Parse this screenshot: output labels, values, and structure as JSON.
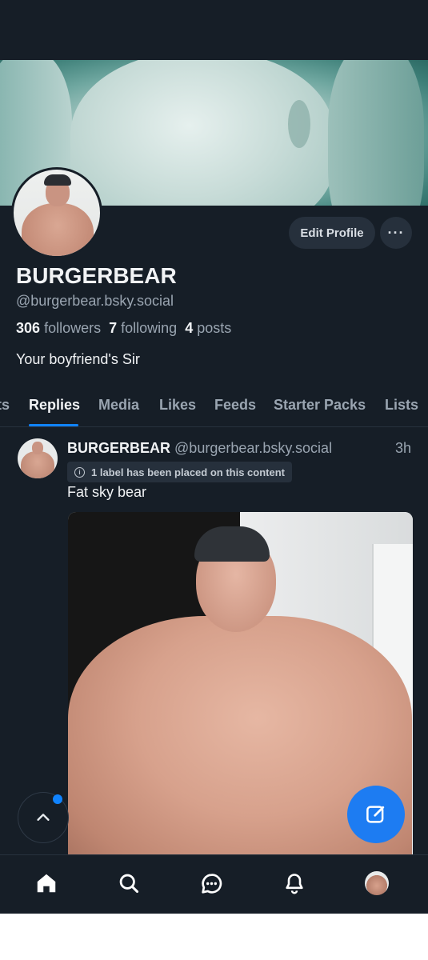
{
  "profile": {
    "display_name": "BURGERBEAR",
    "handle": "@burgerbear.bsky.social",
    "followers_count": "306",
    "followers_label": "followers",
    "following_count": "7",
    "following_label": "following",
    "posts_count": "4",
    "posts_label": "posts",
    "bio": "Your boyfriend's Sir",
    "edit_button": "Edit Profile",
    "more_button": "···"
  },
  "tabs": [
    "ts",
    "Replies",
    "Media",
    "Likes",
    "Feeds",
    "Starter Packs",
    "Lists"
  ],
  "active_tab": "Replies",
  "post": {
    "author": "BURGERBEAR",
    "handle": "@burgerbear.bsky.social",
    "time": "3h",
    "label_notice": "1 label has been placed on this content",
    "text": "Fat sky bear"
  },
  "nav": {
    "icons": [
      "home-icon",
      "search-icon",
      "chat-icon",
      "bell-icon",
      "profile-avatar"
    ]
  },
  "colors": {
    "background": "#161e27",
    "accent": "#1083fe",
    "compose_button": "#1d7cf2"
  }
}
